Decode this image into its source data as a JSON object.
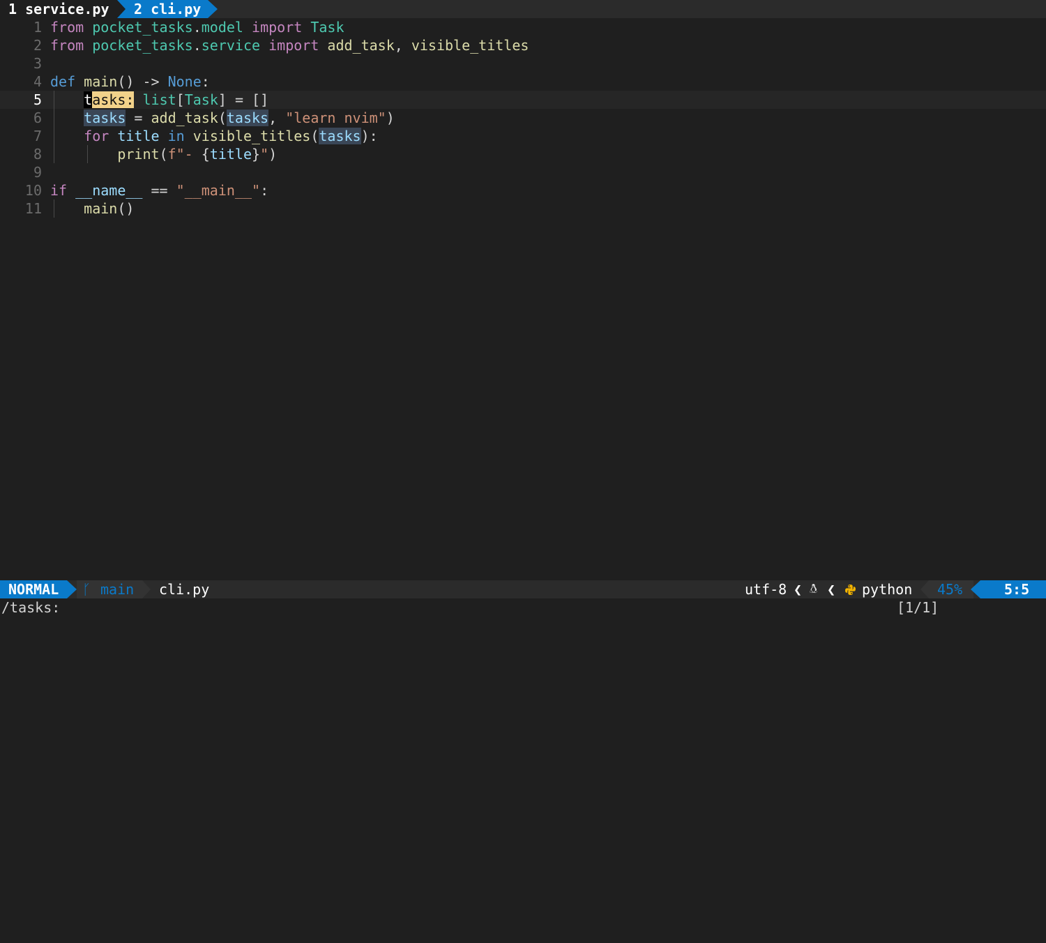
{
  "tabs": [
    {
      "label": "1 service.py",
      "active": false
    },
    {
      "label": "2 cli.py",
      "active": true
    }
  ],
  "editor": {
    "current_line": 5,
    "lines": [
      {
        "n": "1",
        "tokens": [
          [
            "kw",
            "from"
          ],
          [
            "op",
            " "
          ],
          [
            "mod",
            "pocket_tasks"
          ],
          [
            "op",
            "."
          ],
          [
            "mod",
            "model"
          ],
          [
            "op",
            " "
          ],
          [
            "kw",
            "import"
          ],
          [
            "op",
            " "
          ],
          [
            "typ",
            "Task"
          ]
        ]
      },
      {
        "n": "2",
        "tokens": [
          [
            "kw",
            "from"
          ],
          [
            "op",
            " "
          ],
          [
            "mod",
            "pocket_tasks"
          ],
          [
            "op",
            "."
          ],
          [
            "mod",
            "service"
          ],
          [
            "op",
            " "
          ],
          [
            "kw",
            "import"
          ],
          [
            "op",
            " "
          ],
          [
            "fn",
            "add_task"
          ],
          [
            "op",
            ", "
          ],
          [
            "fn",
            "visible_titles"
          ]
        ]
      },
      {
        "n": "3",
        "tokens": []
      },
      {
        "n": "4",
        "tokens": [
          [
            "kw2",
            "def"
          ],
          [
            "op",
            " "
          ],
          [
            "fn",
            "main"
          ],
          [
            "op",
            "() -> "
          ],
          [
            "kw2",
            "None"
          ],
          [
            "op",
            ":"
          ]
        ]
      },
      {
        "n": "5",
        "tokens": [
          [
            "op",
            "    "
          ],
          [
            "cursor",
            "t"
          ],
          [
            "search-hl",
            "asks:"
          ],
          [
            "op",
            " "
          ],
          [
            "typ",
            "list"
          ],
          [
            "op",
            "["
          ],
          [
            "typ",
            "Task"
          ],
          [
            "op",
            "] = []"
          ]
        ]
      },
      {
        "n": "6",
        "tokens": [
          [
            "op",
            "    "
          ],
          [
            "var ref",
            "tasks"
          ],
          [
            "op",
            " = "
          ],
          [
            "fn",
            "add_task"
          ],
          [
            "op",
            "("
          ],
          [
            "var ref",
            "tasks"
          ],
          [
            "op",
            ", "
          ],
          [
            "str",
            "\"learn nvim\""
          ],
          [
            "op",
            ")"
          ]
        ]
      },
      {
        "n": "7",
        "tokens": [
          [
            "op",
            "    "
          ],
          [
            "kw",
            "for"
          ],
          [
            "op",
            " "
          ],
          [
            "var",
            "title"
          ],
          [
            "op",
            " "
          ],
          [
            "kw2",
            "in"
          ],
          [
            "op",
            " "
          ],
          [
            "fn",
            "visible_titles"
          ],
          [
            "op",
            "("
          ],
          [
            "var ref",
            "tasks"
          ],
          [
            "op",
            "):"
          ]
        ]
      },
      {
        "n": "8",
        "tokens": [
          [
            "op",
            "        "
          ],
          [
            "fn",
            "print"
          ],
          [
            "op",
            "("
          ],
          [
            "str",
            "f\"- "
          ],
          [
            "op",
            "{"
          ],
          [
            "var",
            "title"
          ],
          [
            "op",
            "}"
          ],
          [
            "str",
            "\""
          ],
          [
            "op",
            ")"
          ]
        ]
      },
      {
        "n": "9",
        "tokens": []
      },
      {
        "n": "10",
        "tokens": [
          [
            "kw",
            "if"
          ],
          [
            "op",
            " "
          ],
          [
            "var",
            "__name__"
          ],
          [
            "op",
            " == "
          ],
          [
            "str",
            "\"__main__\""
          ],
          [
            "op",
            ":"
          ]
        ]
      },
      {
        "n": "11",
        "tokens": [
          [
            "op",
            "    "
          ],
          [
            "fn",
            "main"
          ],
          [
            "op",
            "()"
          ]
        ]
      }
    ]
  },
  "statusline": {
    "mode": "NORMAL",
    "branch_icon": "git-branch-icon",
    "branch": "main",
    "file": "cli.py",
    "encoding": "utf-8",
    "separator": "❮",
    "os_icon": "linux-icon",
    "filetype_icon": "python-icon",
    "filetype": "python",
    "percent": "45%",
    "position": "5:5"
  },
  "cmdline": {
    "command": "/tasks:",
    "search_count": "[1/1]"
  },
  "colors": {
    "accent": "#0a7aca",
    "background": "#1f1f1f",
    "search_highlight": "#f2d28a"
  }
}
